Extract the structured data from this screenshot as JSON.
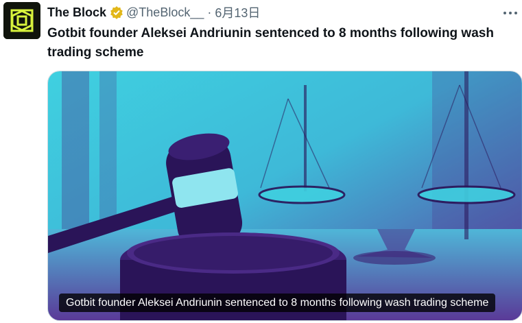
{
  "author": {
    "display_name": "The Block",
    "handle": "@TheBlock__",
    "separator": "·",
    "date": "6月13日",
    "verified_badge_icon": "verified-badge-icon",
    "avatar_icon": "the-block-logo-icon",
    "colors": {
      "logo_bg": "#10140c",
      "logo_accent": "#d8f33d",
      "verified": "#e2b719"
    }
  },
  "tweet": {
    "text": "Gotbit founder Aleksei Andriunin sentenced to 8 months following wash trading scheme",
    "more_icon": "more-options-icon"
  },
  "card": {
    "image_name": "gavel-and-scales-image",
    "caption": "Gotbit founder Aleksei Andriunin sentenced to 8 months following wash trading scheme",
    "colors": {
      "cyan": "#3fd0e0",
      "purple": "#4a2a86",
      "deep_purple": "#2a1458"
    }
  }
}
